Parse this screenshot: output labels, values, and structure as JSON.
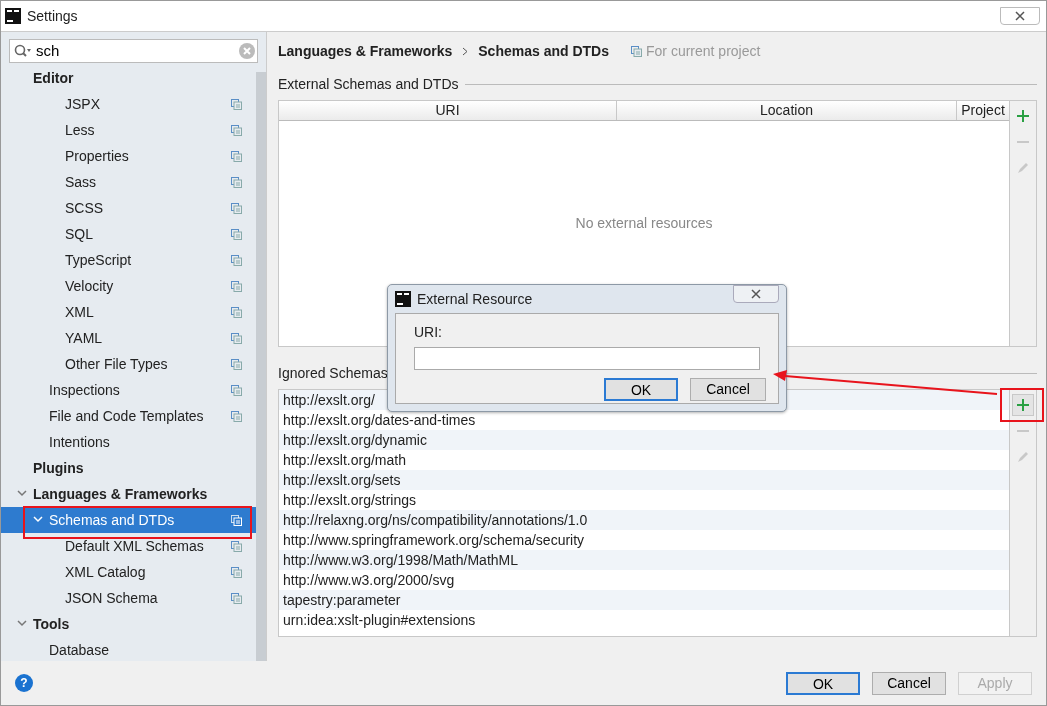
{
  "window": {
    "title": "Settings"
  },
  "sidebar": {
    "search": {
      "value": "sch"
    },
    "tree": [
      {
        "label": "Editor",
        "bold": true,
        "children": [
          {
            "children": [
              {
                "label": "JSPX",
                "project_scope": true
              },
              {
                "label": "Less",
                "project_scope": true
              },
              {
                "label": "Properties",
                "project_scope": true
              },
              {
                "label": "Sass",
                "project_scope": true
              },
              {
                "label": "SCSS",
                "project_scope": true
              },
              {
                "label": "SQL",
                "project_scope": true
              },
              {
                "label": "TypeScript",
                "project_scope": true
              },
              {
                "label": "Velocity",
                "project_scope": true
              },
              {
                "label": "XML",
                "project_scope": true
              },
              {
                "label": "YAML",
                "project_scope": true
              },
              {
                "label": "Other File Types",
                "project_scope": true
              }
            ]
          },
          {
            "label": "Inspections",
            "project_scope": true
          },
          {
            "label": "File and Code Templates",
            "project_scope": true
          },
          {
            "label": "Intentions",
            "project_scope": false
          }
        ]
      },
      {
        "label": "Plugins",
        "bold": true
      },
      {
        "label": "Languages & Frameworks",
        "bold": true,
        "expanded": true,
        "children": [
          {
            "label": "Schemas and DTDs",
            "selected": true,
            "marked": true,
            "expanded": true,
            "project_scope": true,
            "children": [
              {
                "label": "Default XML Schemas",
                "project_scope": true
              },
              {
                "label": "XML Catalog",
                "project_scope": true
              },
              {
                "label": "JSON Schema",
                "project_scope": true
              }
            ]
          }
        ]
      },
      {
        "label": "Tools",
        "bold": true,
        "expanded": true,
        "children": [
          {
            "label": "Database",
            "project_scope": false
          }
        ]
      }
    ]
  },
  "breadcrumb": [
    "Languages & Frameworks",
    "Schemas and DTDs"
  ],
  "scope_note": "For current project",
  "external": {
    "title": "External Schemas and DTDs",
    "columns": [
      "URI",
      "Location",
      "Project"
    ],
    "empty_text": "No external resources",
    "toolbar": [
      {
        "kind": "add",
        "disabled": false
      },
      {
        "kind": "remove",
        "disabled": true
      },
      {
        "kind": "edit",
        "disabled": true
      }
    ]
  },
  "ignored": {
    "title": "Ignored Schemas",
    "rows": [
      "http://exslt.org/",
      "http://exslt.org/dates-and-times",
      "http://exslt.org/dynamic",
      "http://exslt.org/math",
      "http://exslt.org/sets",
      "http://exslt.org/strings",
      "http://relaxng.org/ns/compatibility/annotations/1.0",
      "http://www.springframework.org/schema/security",
      "http://www.w3.org/1998/Math/MathML",
      "http://www.w3.org/2000/svg",
      "tapestry:parameter",
      "urn:idea:xslt-plugin#extensions"
    ],
    "toolbar": [
      {
        "kind": "add",
        "disabled": false,
        "marked": true
      },
      {
        "kind": "remove",
        "disabled": true
      },
      {
        "kind": "edit",
        "disabled": true
      }
    ]
  },
  "callout_arrow": true,
  "dialog": {
    "title": "External Resource",
    "field_label": "URI:",
    "buttons": [
      {
        "label": "OK",
        "default": true
      },
      {
        "label": "Cancel",
        "default": false
      }
    ]
  },
  "footer": {
    "help": "?",
    "buttons": [
      {
        "label": "OK",
        "default": true,
        "disabled": false
      },
      {
        "label": "Cancel",
        "default": false,
        "disabled": false
      },
      {
        "label": "Apply",
        "default": false,
        "disabled": true
      }
    ]
  }
}
